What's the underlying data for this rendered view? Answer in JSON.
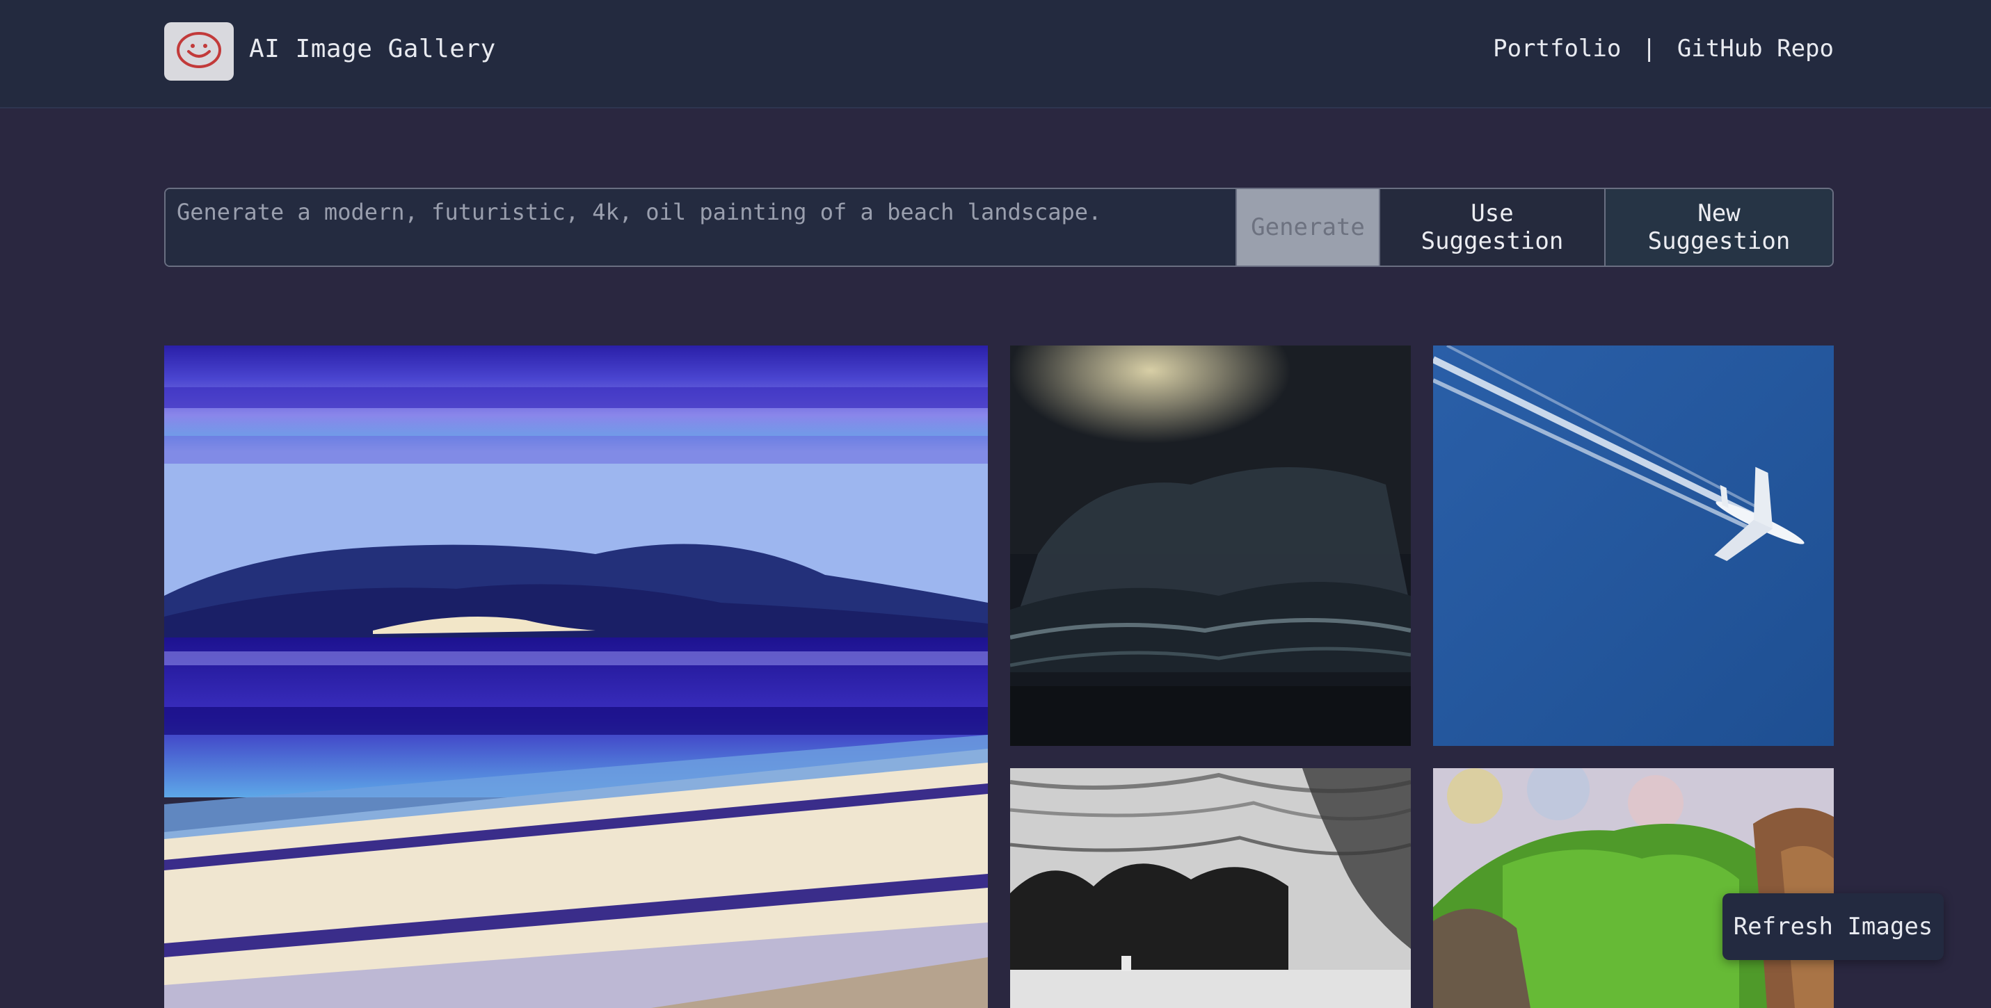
{
  "header": {
    "title": "AI Image Gallery",
    "logo_icon": "smiley-face-icon",
    "nav": {
      "portfolio": "Portfolio",
      "separator": "|",
      "github": "GitHub Repo"
    }
  },
  "prompt": {
    "placeholder": "Generate a modern, futuristic, 4k, oil painting of a beach landscape.",
    "value": "",
    "generate_label": "Generate",
    "use_suggestion_label": "Use Suggestion",
    "new_suggestion_label": "New Suggestion"
  },
  "gallery": {
    "images": [
      {
        "subject": "oil painting of a beach landscape in blue and purple"
      },
      {
        "subject": "dark stormy cloud painting"
      },
      {
        "subject": "airplane with contrail in blue sky"
      },
      {
        "subject": "black and white sketch of trees"
      },
      {
        "subject": "green hills and rocks painting"
      }
    ]
  },
  "refresh_label": "Refresh Images",
  "colors": {
    "background": "#2a2740",
    "header_bg": "#232a3f",
    "logo_accent": "#c0392b"
  }
}
